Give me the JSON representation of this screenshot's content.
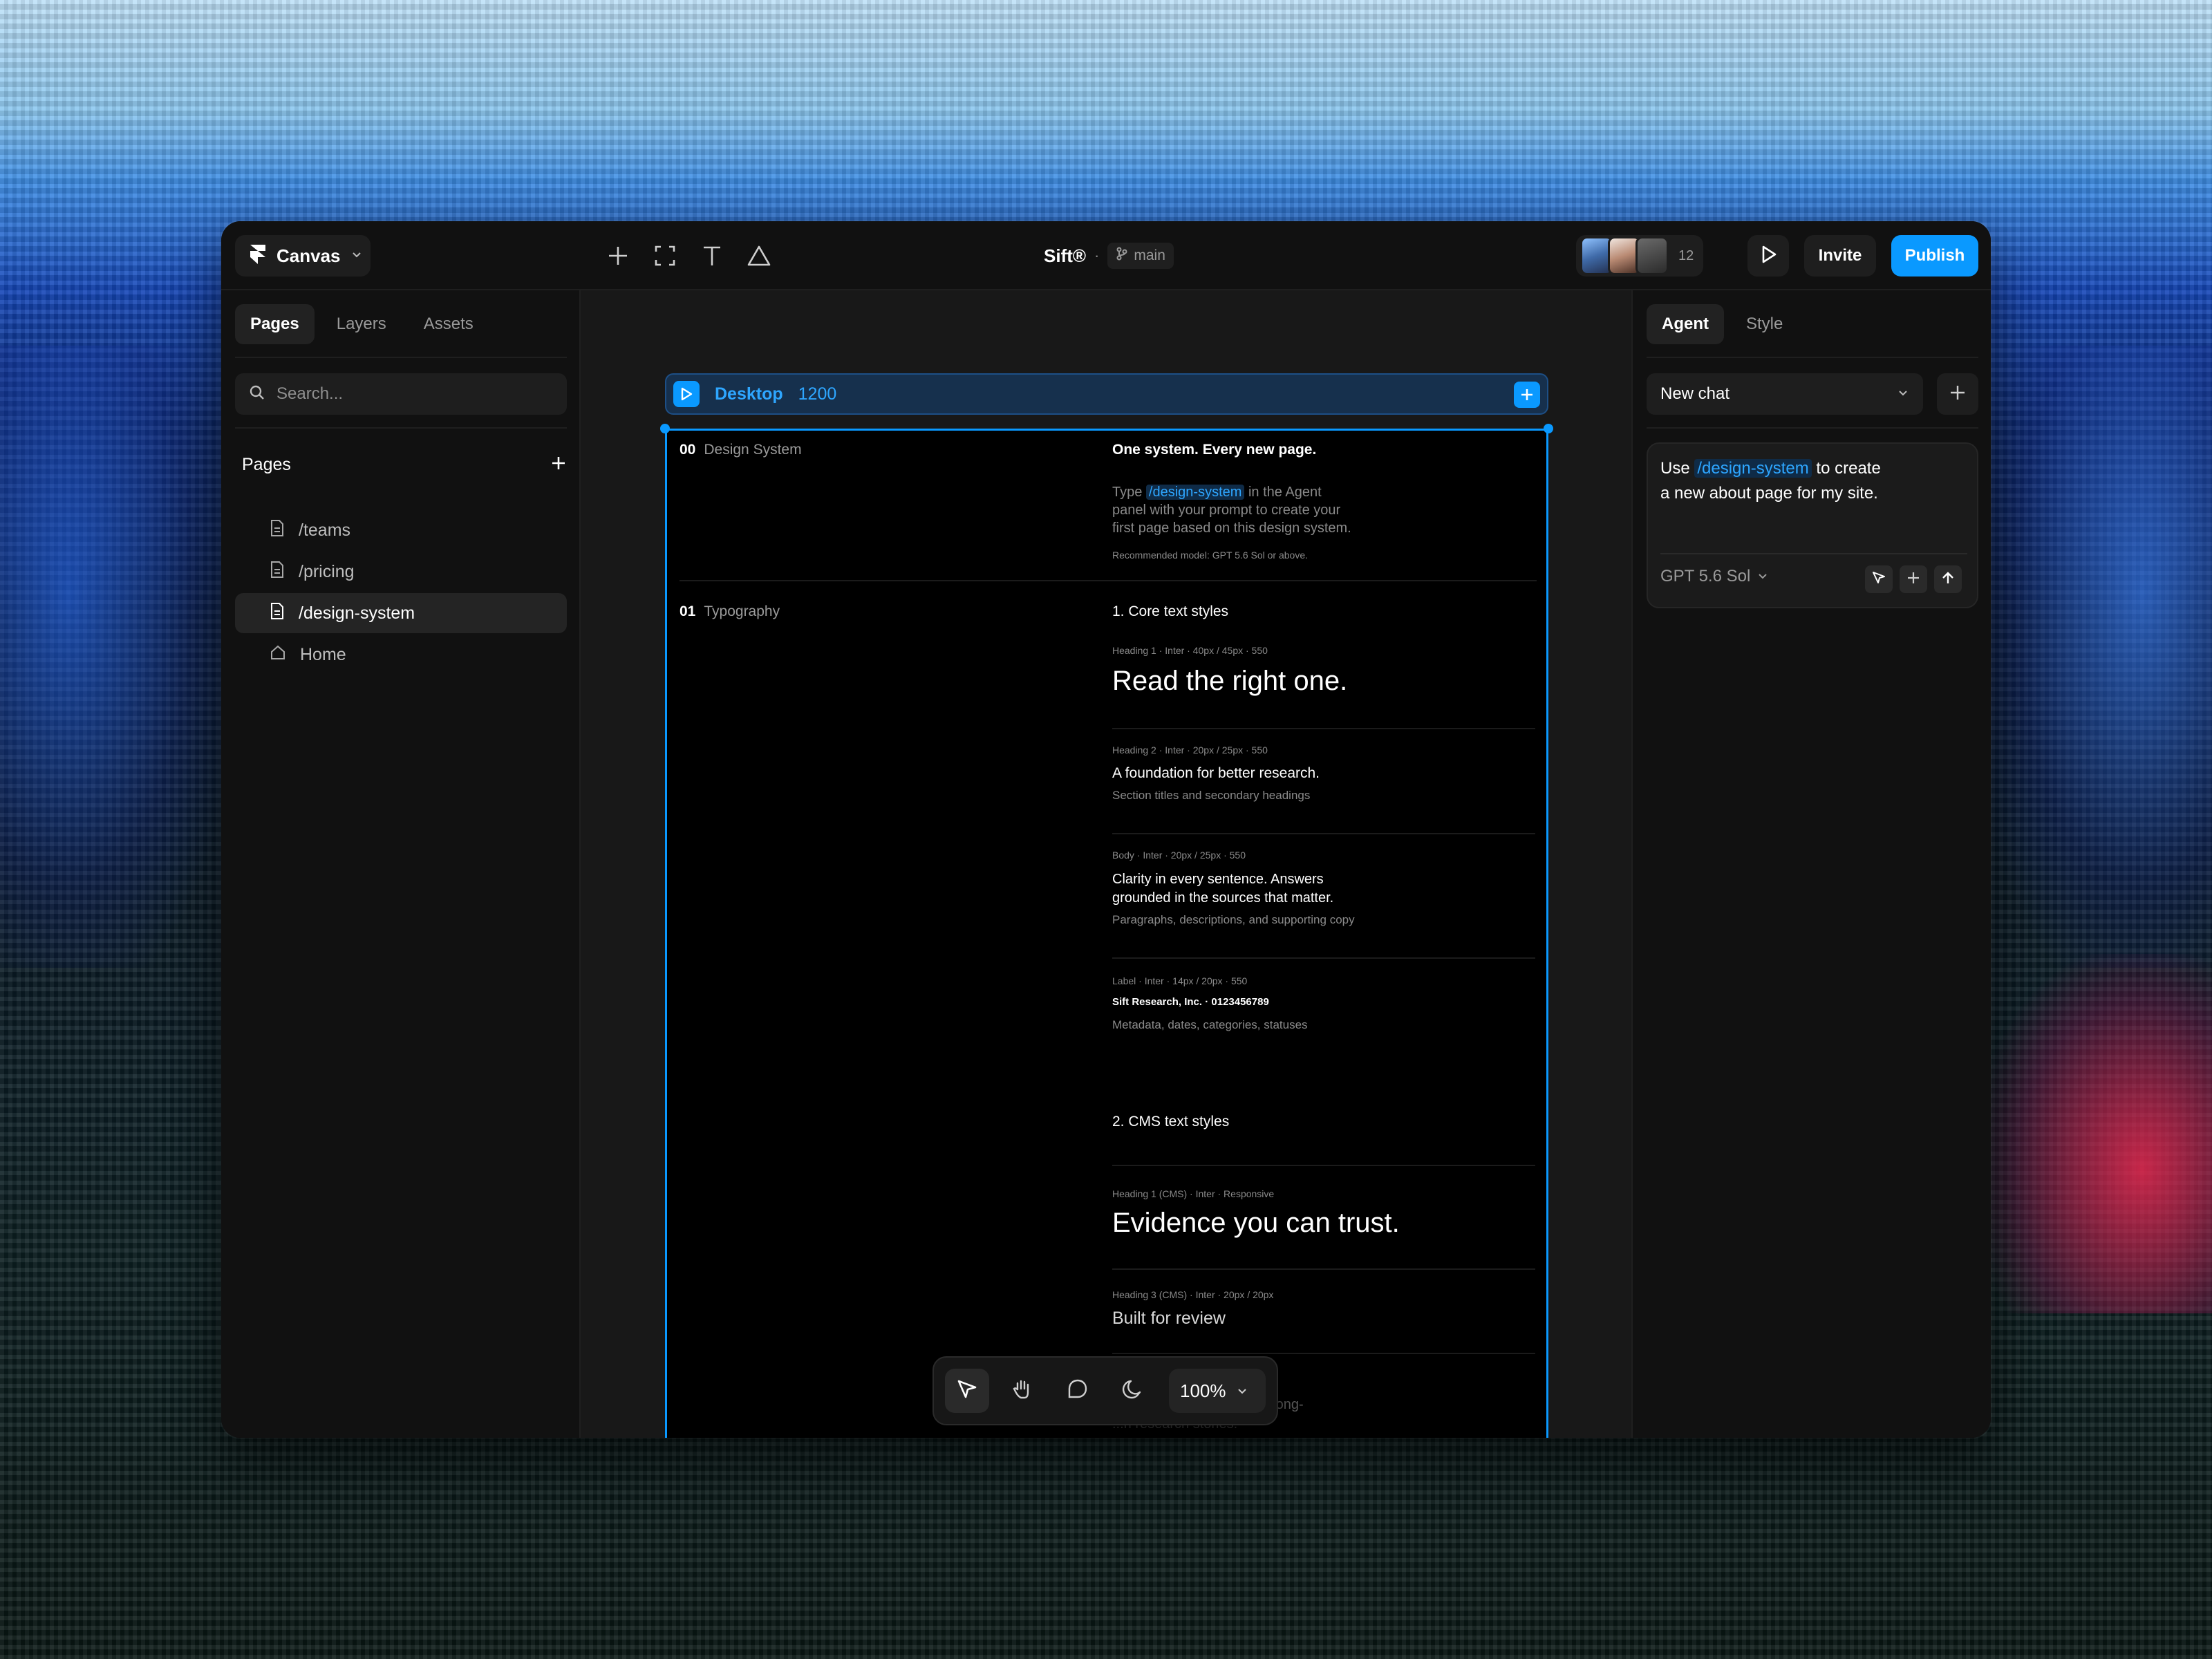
{
  "topbar": {
    "workspace_label": "Canvas",
    "project_title": "Sift®",
    "separator": "·",
    "branch": "main",
    "collaborator_count": "12",
    "invite_label": "Invite",
    "publish_label": "Publish"
  },
  "left_panel": {
    "tabs": [
      "Pages",
      "Layers",
      "Assets"
    ],
    "search_placeholder": "Search...",
    "pages_heading": "Pages",
    "pages": [
      {
        "label": "/teams",
        "icon": "page-icon"
      },
      {
        "label": "/pricing",
        "icon": "page-icon"
      },
      {
        "label": "/design-system",
        "icon": "page-icon",
        "selected": true
      },
      {
        "label": "Home",
        "icon": "home-icon"
      }
    ]
  },
  "canvas": {
    "frame_name": "Desktop",
    "frame_width": "1200",
    "sections": {
      "s0_num": "00",
      "s0_title": "Design System",
      "s0_heading": "One system. Every new page.",
      "s0_body_pre": "Type",
      "s0_body_chip": "/design-system",
      "s0_body_line1": "in the Agent",
      "s0_body_line2": "panel with your prompt to create your",
      "s0_body_line3": "first page based on this design system.",
      "s0_note": "Recommended model: GPT 5.6 Sol or above.",
      "s1_num": "01",
      "s1_title": "Typography",
      "core_heading": "1. Core text styles",
      "h1_spec": "Heading 1 · Inter · 40px / 45px · 550",
      "h1_sample": "Read the right one.",
      "h2_spec": "Heading 2 · Inter · 20px / 25px · 550",
      "h2_sample": "A foundation for better research.",
      "h2_desc": "Section titles and secondary headings",
      "body_spec": "Body · Inter · 20px / 25px · 550",
      "body_sample_1": "Clarity in every sentence. Answers",
      "body_sample_2": "grounded in the sources that matter.",
      "body_desc": "Paragraphs, descriptions, and supporting copy",
      "label_spec": "Label · Inter · 14px / 20px · 550",
      "label_sample": "Sift Research, Inc. · 0123456789",
      "label_desc": "Metadata, dates, categories, statuses",
      "cms_heading": "2. CMS text styles",
      "cms_h1_spec": "Heading 1 (CMS) · Inter · Responsive",
      "cms_h1_sample": "Evidence you can trust.",
      "cms_h3_spec": "Heading 3 (CMS) · Inter · 20px / 20px",
      "cms_h3_sample": "Built for review",
      "partial_1": "r long-",
      "partial_2": "...n research stories."
    }
  },
  "bottom_toolbar": {
    "zoom": "100%",
    "tools": [
      "pointer-icon",
      "hand-icon",
      "comment-icon",
      "moon-icon"
    ]
  },
  "right_panel": {
    "tabs": [
      "Agent",
      "Style"
    ],
    "chat_select": "New chat",
    "prompt_pre": "Use",
    "prompt_chip": "/design-system",
    "prompt_post_1": "to create",
    "prompt_post_2": "a new about page for my site.",
    "model": "GPT 5.6 Sol"
  },
  "colors": {
    "accent": "#0a99ff",
    "window_bg": "#111111",
    "canvas_bg": "#181818",
    "frame_bg": "#000000"
  }
}
